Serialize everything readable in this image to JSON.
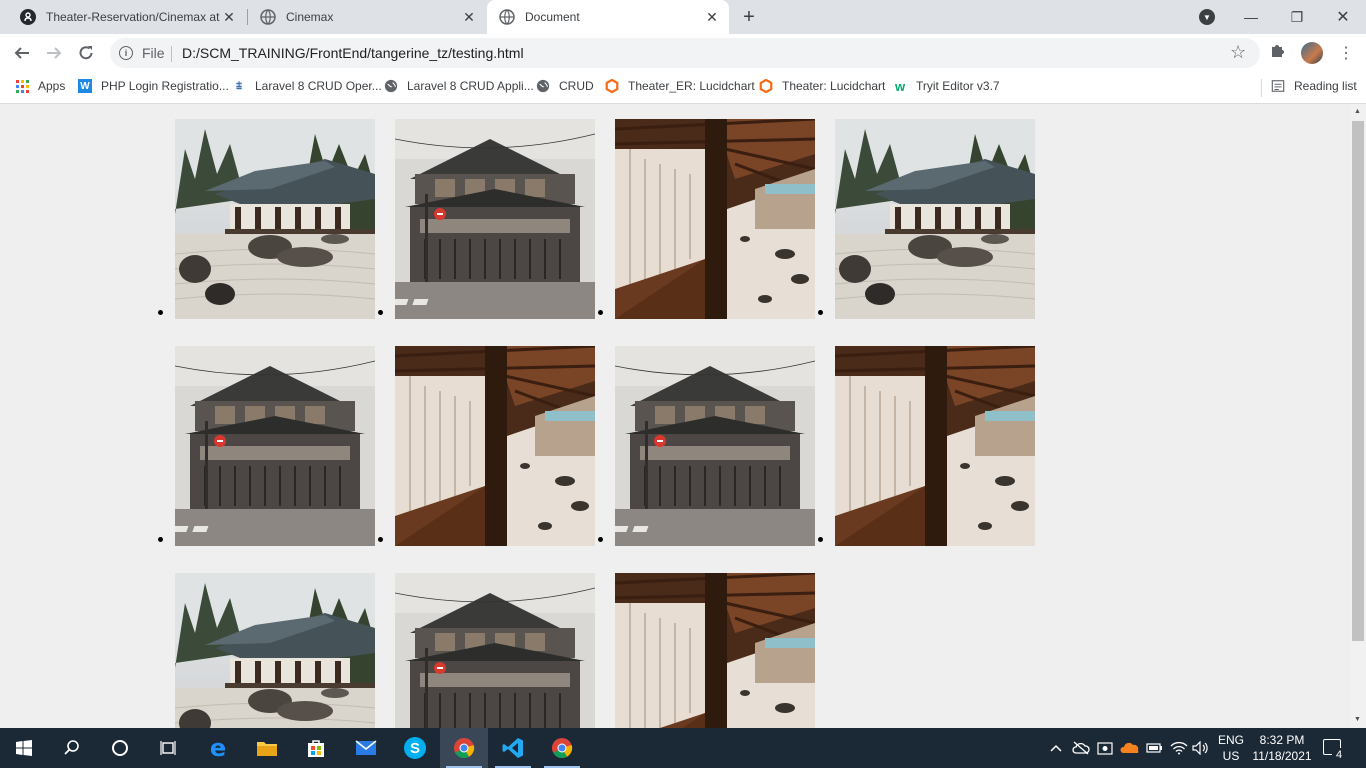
{
  "tabs": [
    {
      "title": "Theater-Reservation/Cinemax at develop",
      "icon": "github-icon"
    },
    {
      "title": "Cinemax",
      "icon": "globe-icon"
    },
    {
      "title": "Document",
      "icon": "globe-icon",
      "active": true
    }
  ],
  "new_tab_label": "+",
  "address_bar": {
    "scheme_label": "File",
    "url": "D:/SCM_TRAINING/FrontEnd/tangerine_tz/testing.html"
  },
  "bookmarks": [
    {
      "label": "Apps",
      "icon": "apps-grid-icon"
    },
    {
      "label": "PHP Login Registratio...",
      "icon": "w-logo-icon"
    },
    {
      "label": "Laravel 8 CRUD Oper...",
      "icon": "laravel-icon"
    },
    {
      "label": "Laravel 8 CRUD Appli...",
      "icon": "globe-icon"
    },
    {
      "label": "CRUD",
      "icon": "globe-icon"
    },
    {
      "label": "Theater_ER: Lucidchart",
      "icon": "lucidchart-icon"
    },
    {
      "label": "Theater: Lucidchart",
      "icon": "lucidchart-icon"
    },
    {
      "label": "Tryit Editor v3.7",
      "icon": "w3schools-icon"
    }
  ],
  "reading_list_label": "Reading list",
  "gallery": {
    "items": [
      {
        "scene": "temple"
      },
      {
        "scene": "street-house"
      },
      {
        "scene": "corridor"
      },
      {
        "scene": "temple"
      },
      {
        "scene": "street-house"
      },
      {
        "scene": "corridor"
      },
      {
        "scene": "street-house"
      },
      {
        "scene": "corridor"
      },
      {
        "scene": "temple"
      },
      {
        "scene": "street-house"
      },
      {
        "scene": "corridor"
      }
    ]
  },
  "taskbar": {
    "apps": [
      "windows-start-icon",
      "search-icon",
      "cortana-icon",
      "task-view-icon",
      "edge-icon",
      "file-explorer-icon",
      "store-icon",
      "mail-icon",
      "skype-icon",
      "chrome-icon",
      "vscode-icon",
      "chrome-icon"
    ],
    "lang_line1": "ENG",
    "lang_line2": "US",
    "time": "8:32 PM",
    "date": "11/18/2021",
    "notification_count": "4"
  },
  "colors": {
    "taskbar": "#1b2836",
    "tab_strip": "#dee1e6",
    "page_bg": "#efefef"
  }
}
